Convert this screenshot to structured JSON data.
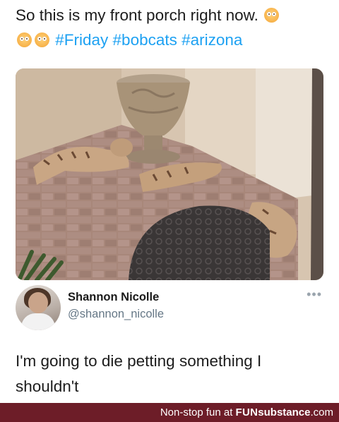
{
  "tweet": {
    "headline": "So this is my front porch right now.",
    "hashtags": "#Friday #bobcats #arizona",
    "emoji": "flushed-face-emoji"
  },
  "photo": {
    "scene": "bobcat-kittens-porch-photo"
  },
  "author": {
    "name": "Shannon Nicolle",
    "handle": "@shannon_nicolle",
    "more": "•••"
  },
  "reply": {
    "text": "I'm going to die petting something I shouldn't"
  },
  "footer": {
    "prefix": "Non-stop fun at",
    "brand_a": "FUN",
    "brand_b": "substance",
    "brand_c": ".com",
    "color": "#6d1d28"
  }
}
